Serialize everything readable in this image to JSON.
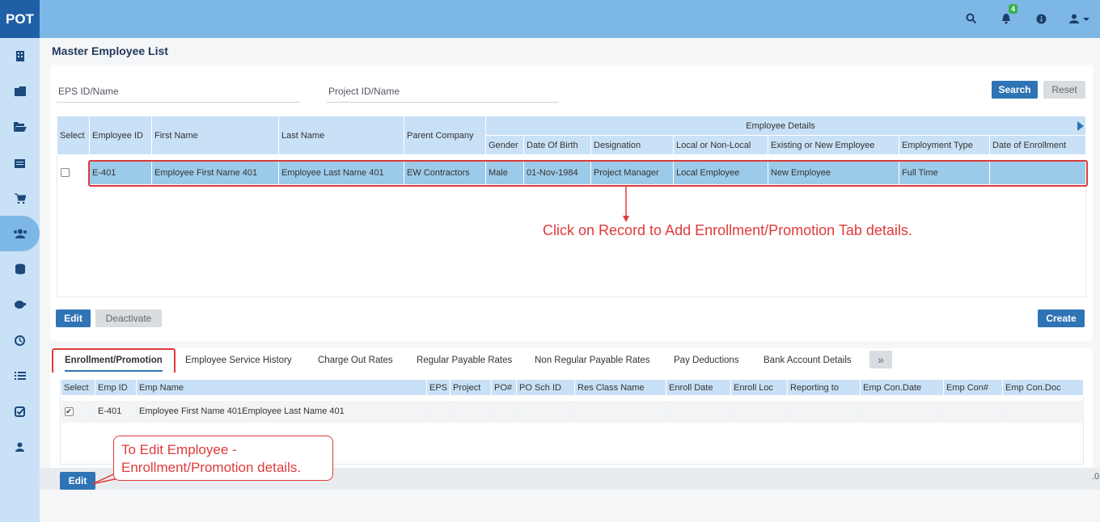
{
  "app": {
    "logo": "POT",
    "notification_count": "4"
  },
  "header_icons": [
    "search-icon",
    "bell-icon",
    "info-icon",
    "user-icon"
  ],
  "sidebar_icons": [
    "building-icon",
    "folder-icon",
    "folder-open-icon",
    "calendar-icon",
    "cart-icon",
    "users-icon",
    "database-icon",
    "piggy-bank-icon",
    "clock-icon",
    "list-icon",
    "check-square-icon",
    "user-icon"
  ],
  "page": {
    "title": "Master Employee List"
  },
  "filters": {
    "eps": "EPS ID/Name",
    "project": "Project ID/Name",
    "search": "Search",
    "reset": "Reset"
  },
  "grid": {
    "headers": {
      "select": "Select",
      "emp_id": "Employee ID",
      "first": "First Name",
      "last": "Last Name",
      "parent": "Parent Company",
      "group": "Employee Details"
    },
    "subheaders": [
      "Gender",
      "Date Of Birth",
      "Designation",
      "Local or Non-Local",
      "Existing or New Employee",
      "Employment Type",
      "Date of Enrollment"
    ],
    "row": {
      "emp_id": "E-401",
      "first": "Employee First Name 401",
      "last": "Employee Last Name 401",
      "parent": "EW Contractors",
      "gender": "Male",
      "dob": "01-Nov-1984",
      "designation": "Project Manager",
      "local": "Local Employee",
      "existing": "New Employee",
      "type": "Full Time",
      "enroll": ""
    }
  },
  "actions": {
    "edit": "Edit",
    "deactivate": "Deactivate",
    "create": "Create"
  },
  "callouts": {
    "record": "Click on Record to Add Enrollment/Promotion Tab details.",
    "edit_line1": "To Edit Employee -",
    "edit_line2": "Enrollment/Promotion details."
  },
  "tabs": [
    "Enrollment/Promotion",
    "Employee Service History",
    "Charge Out Rates",
    "Regular Payable Rates",
    "Non Regular Payable Rates",
    "Pay Deductions",
    "Bank Account Details"
  ],
  "tab_more": "»",
  "grid2": {
    "headers": [
      "Select",
      "Emp ID",
      "Emp Name",
      "EPS",
      "Project",
      "PO#",
      "PO Sch ID",
      "Res Class Name",
      "Enroll Date",
      "Enroll Loc",
      "Reporting to",
      "Emp Con.Date",
      "Emp Con#",
      "Emp Con.Doc"
    ],
    "row": {
      "emp_id": "E-401",
      "name": "Employee First Name 401Employee Last Name 401"
    },
    "edit": "Edit"
  },
  "edge_text": ".0",
  "colors": {
    "topbar": "#7db7e6",
    "accent": "#2f74b5",
    "callout": "#e03a3a"
  }
}
